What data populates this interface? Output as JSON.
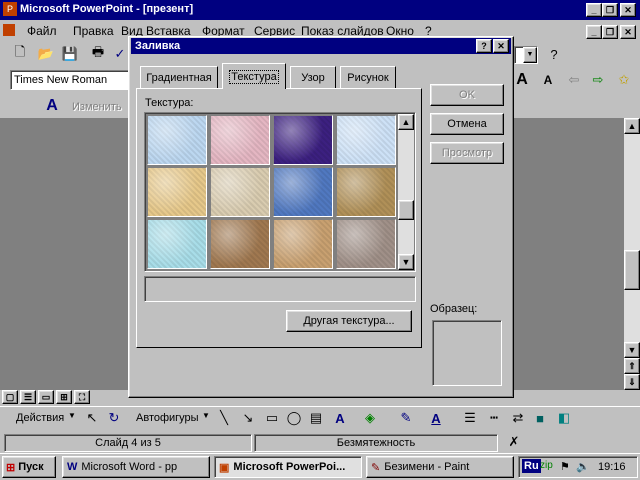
{
  "app": {
    "title": "Microsoft PowerPoint - [презент]"
  },
  "menu": [
    "Файл",
    "Правка",
    "Вид",
    "Вставка",
    "Формат",
    "Сервис",
    "Показ слайдов",
    "Окно",
    "?"
  ],
  "format": {
    "font": "Times New Roman"
  },
  "drawtb": {
    "change_label": "Изменить"
  },
  "dialog": {
    "title": "Заливка",
    "help_btn": "?",
    "close_btn": "✕",
    "tabs": [
      "Градиентная",
      "Текстура",
      "Узор",
      "Рисунок"
    ],
    "texture_label": "Текстура:",
    "textures": [
      "#bcd7f0",
      "#e4b6c2",
      "#3c2080",
      "#cde1f6",
      "#e6c88a",
      "#d9ccb0",
      "#5078c0",
      "#b09058",
      "#a8dde8",
      "#a07850",
      "#c8a070",
      "#a09088"
    ],
    "ok": "OK",
    "cancel": "Отмена",
    "preview": "Просмотр",
    "other_texture": "Другая текстура...",
    "sample_label": "Образец:"
  },
  "drawing_toolbar": {
    "actions": "Действия",
    "autoshapes": "Автофигуры"
  },
  "status": {
    "slide": "Слайд 4 из 5",
    "template": "Безмятежность"
  },
  "taskbar": {
    "start": "Пуск",
    "items": [
      "Microsoft Word - pp",
      "Microsoft PowerPoi...",
      "Безимени - Paint"
    ],
    "lang": "Ru",
    "time": "19:16"
  }
}
